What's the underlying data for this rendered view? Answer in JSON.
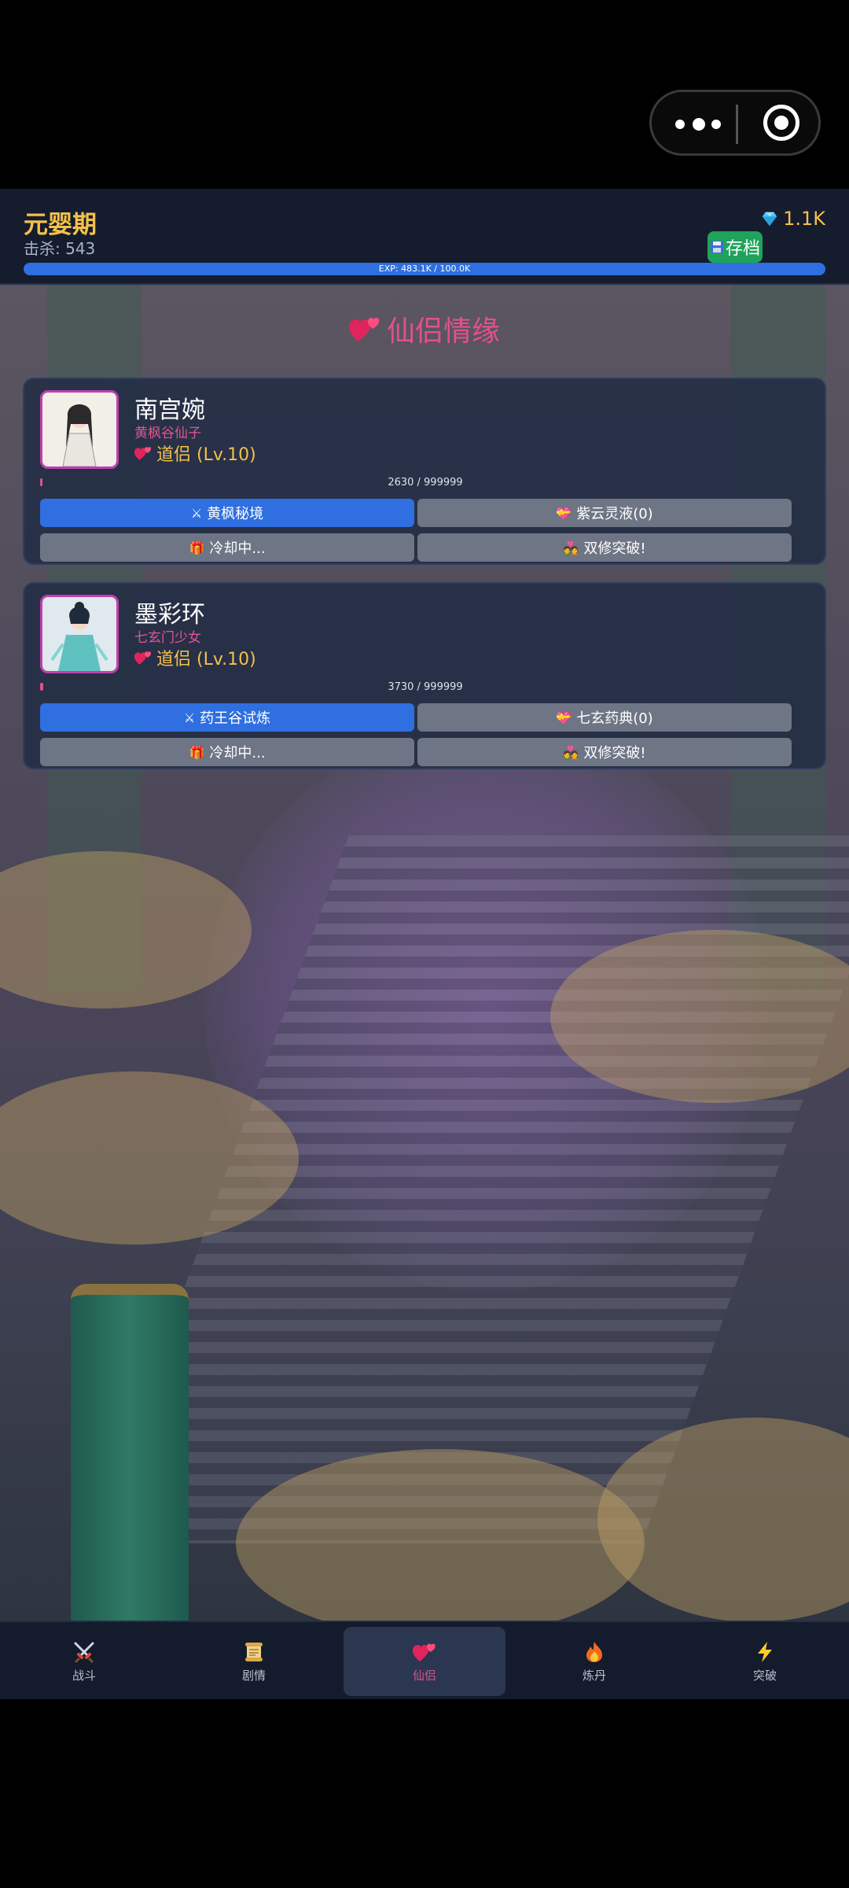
{
  "header": {
    "realm": "元婴期",
    "kills": "击杀: 543",
    "gems": "1.1K",
    "save_label": "存档",
    "exp_text": "EXP: 483.1K / 100.0K",
    "exp_progress": 1.0
  },
  "page": {
    "title": "仙侣情缘"
  },
  "companions": [
    {
      "name": "南宫婉",
      "subtitle": "黄枫谷仙子",
      "relation": "道侣 (Lv.10)",
      "favor_text": "2630 / 999999",
      "favor_progress": 0.0026,
      "actions": [
        "黄枫秘境",
        "紫云灵液(0)",
        "冷却中...",
        "双修突破!"
      ]
    },
    {
      "name": "墨彩环",
      "subtitle": "七玄门少女",
      "relation": "道侣 (Lv.10)",
      "favor_text": "3730 / 999999",
      "favor_progress": 0.0037,
      "actions": [
        "药王谷试炼",
        "七玄药典(0)",
        "冷却中...",
        "双修突破!"
      ]
    }
  ],
  "nav": [
    {
      "label": "战斗",
      "icon": "crossed-swords-icon"
    },
    {
      "label": "剧情",
      "icon": "scroll-icon"
    },
    {
      "label": "仙侣",
      "icon": "hearts-icon",
      "active": true
    },
    {
      "label": "炼丹",
      "icon": "fire-icon"
    },
    {
      "label": "突破",
      "icon": "lightning-icon"
    }
  ],
  "colors": {
    "accent_pink": "#e4508a",
    "gold": "#f3c14b",
    "blue": "#2f6fe0",
    "save_green": "#1fa35a"
  }
}
